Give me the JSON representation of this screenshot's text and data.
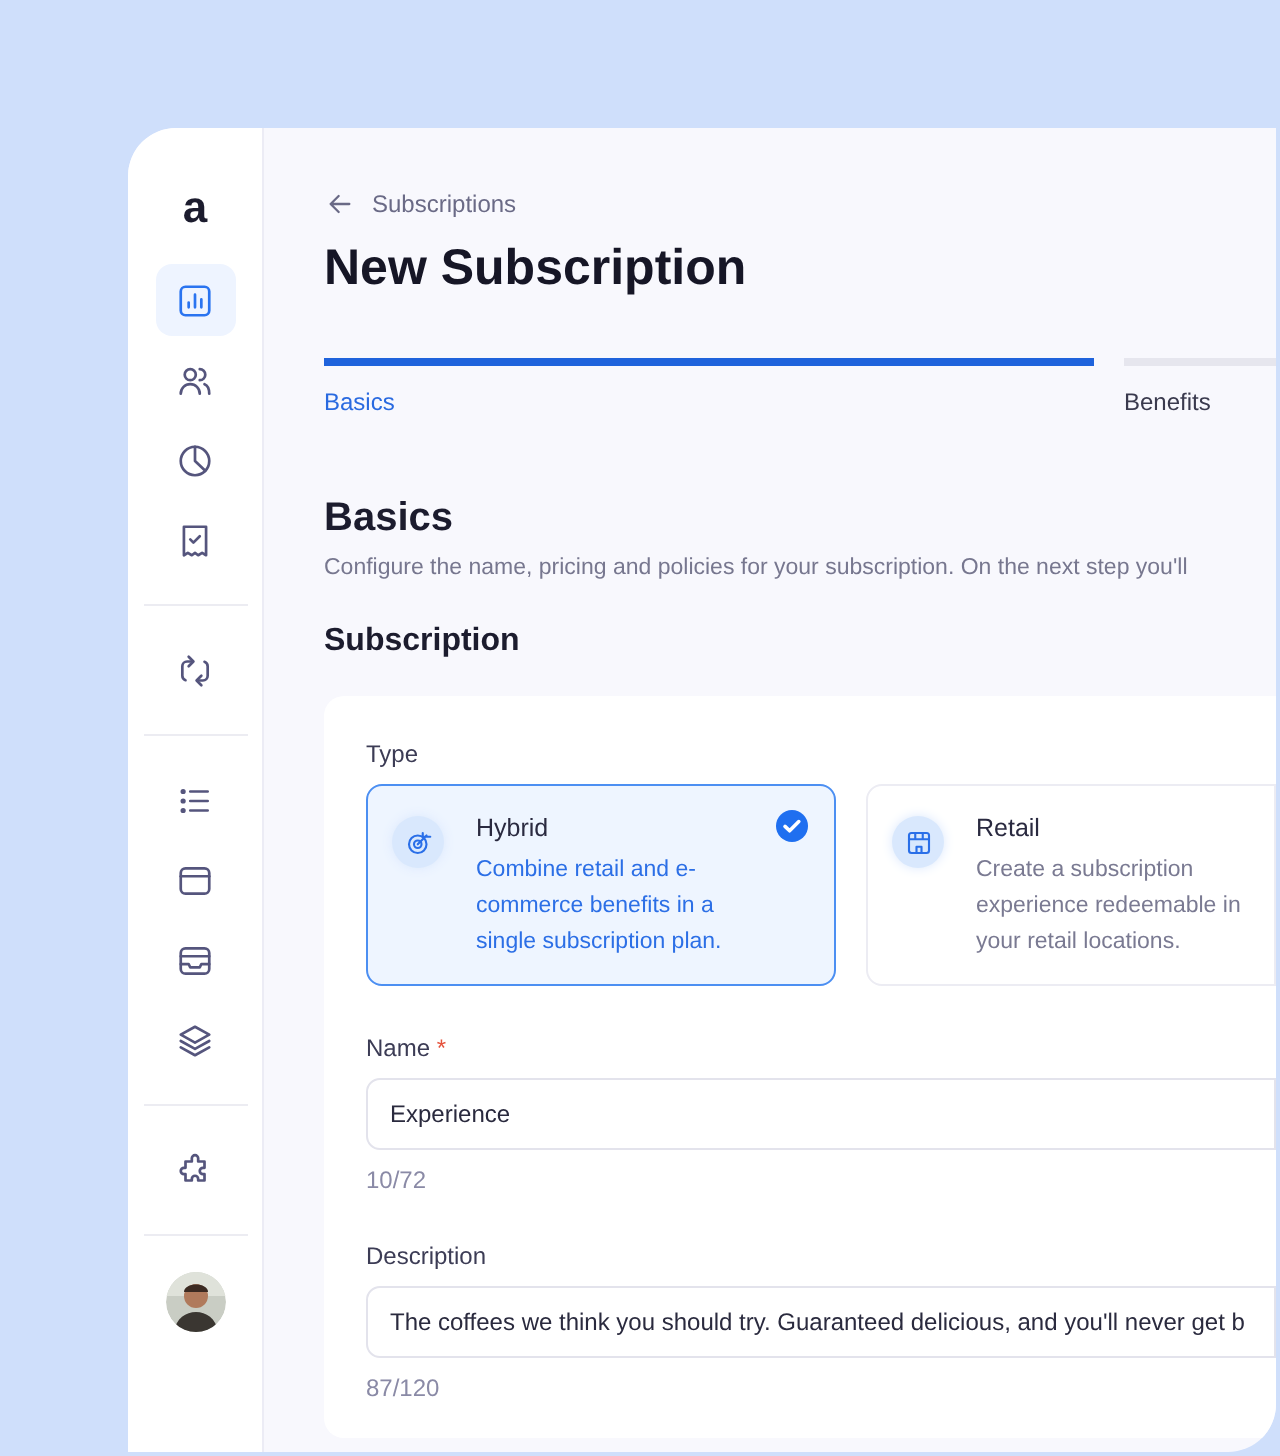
{
  "sidebar": {
    "logo": "a",
    "groups": [
      [
        {
          "selected": true
        },
        {
          "selected": false
        },
        {
          "selected": false
        },
        {
          "selected": false
        }
      ],
      [
        {
          "selected": false
        }
      ],
      [
        {
          "selected": false
        },
        {
          "selected": false
        },
        {
          "selected": false
        },
        {
          "selected": false
        }
      ],
      [
        {
          "selected": false
        }
      ]
    ],
    "avatar": {
      "kind": "picture"
    }
  },
  "breadcrumb": "Subscriptions",
  "title": "New Subscription",
  "steps": [
    {
      "label": "Basics",
      "selected": true
    },
    {
      "label": "Benefits",
      "selected": false
    }
  ],
  "section": {
    "heading": "Basics",
    "description": "Configure the name, pricing and policies for your subscription. On the next step you'll"
  },
  "subsection": "Subscription",
  "card": {
    "type_label": "Type",
    "types": [
      {
        "kind": "hybrid",
        "title": "Hybrid",
        "description": "Combine retail and e-commerce benefits in a single subscription plan.",
        "selected": true
      },
      {
        "kind": "retail",
        "title": "Retail",
        "description": "Create a subscription experience redeemable in your retail locations.",
        "selected": false
      }
    ],
    "fields": [
      {
        "label": "Name",
        "required_mark": "*",
        "value": "Experience",
        "counter": "10/72"
      },
      {
        "label": "Description",
        "value": "The coffees we think you should try. Guaranteed delicious, and you'll never get b",
        "counter": "87/120"
      }
    ]
  }
}
